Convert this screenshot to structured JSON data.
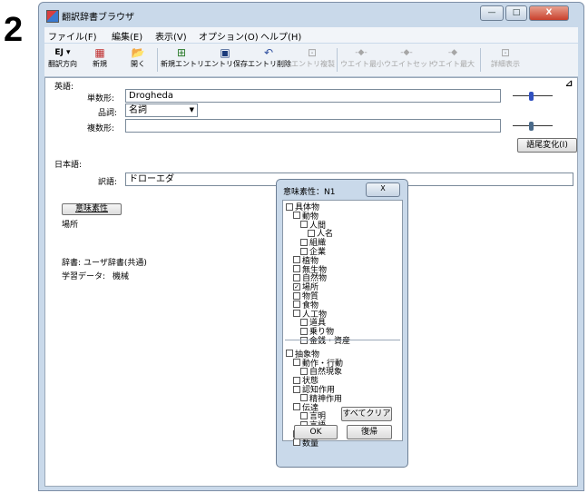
{
  "step_number": "2",
  "window": {
    "title": "翻訳辞書ブラウザ",
    "controls": [
      "—",
      "□",
      "X"
    ]
  },
  "menu": [
    "ファイル(F)",
    "編集(E)",
    "表示(V)",
    "オプション(O)",
    "ヘルプ(H)"
  ],
  "toolbar": [
    {
      "icon": "EJ ▾",
      "label": "翻訳方向",
      "disabled": false
    },
    {
      "icon": "▦",
      "label": "新規",
      "disabled": false
    },
    {
      "icon": "📂",
      "label": "開く",
      "disabled": false
    },
    {
      "icon": "⊞",
      "label": "新規エントリ",
      "disabled": false
    },
    {
      "icon": "▣",
      "label": "エントリ保存",
      "disabled": false
    },
    {
      "icon": "↶",
      "label": "エントリ削除",
      "disabled": false
    },
    {
      "icon": "⊡",
      "label": "エントリ複製",
      "disabled": true
    },
    {
      "icon": "-◆-",
      "label": "ウエイト最小",
      "disabled": true
    },
    {
      "icon": "-◆-",
      "label": "ウエイトセット",
      "disabled": true
    },
    {
      "icon": "-◆",
      "label": "ウエイト最大",
      "disabled": true
    },
    {
      "icon": "⊡",
      "label": "詳細表示",
      "disabled": true
    }
  ],
  "english": {
    "section_label": "英語:",
    "singular_label": "単数形:",
    "singular_value": "Drogheda",
    "pos_label": "品詞:",
    "pos_value": "名詞",
    "plural_label": "複数形:",
    "plural_value": "",
    "inflection_button": "語尾変化(I)",
    "corner_icon": "⊿"
  },
  "japanese": {
    "section_label": "日本語:",
    "translation_label": "訳語:",
    "translation_value": "ドローエダ"
  },
  "semantic_button": "意味素性",
  "semantic_value": "場所",
  "dictionary_label": "辞書:",
  "dictionary_value": "ユーザ辞書(共通)",
  "learning_label": "学習データ:",
  "learning_value": "機械",
  "popup": {
    "title": "意味素性：N1",
    "close_label": "X",
    "clear_all": "すべてクリア",
    "ok": "OK",
    "restore": "復帰",
    "categories": [
      {
        "label": "具体物",
        "checked": false,
        "level": 0
      },
      {
        "label": "動物",
        "checked": false,
        "level": 1
      },
      {
        "label": "人間",
        "checked": false,
        "level": 2
      },
      {
        "label": "人名",
        "checked": false,
        "level": 3
      },
      {
        "label": "組織",
        "checked": false,
        "level": 2
      },
      {
        "label": "企業",
        "checked": false,
        "level": 2
      },
      {
        "label": "植物",
        "checked": false,
        "level": 1
      },
      {
        "label": "無生物",
        "checked": false,
        "level": 1
      },
      {
        "label": "自然物",
        "checked": false,
        "level": 1
      },
      {
        "label": "場所",
        "checked": true,
        "level": 1
      },
      {
        "label": "物質",
        "checked": false,
        "level": 1
      },
      {
        "label": "食物",
        "checked": false,
        "level": 1
      },
      {
        "label": "人工物",
        "checked": false,
        "level": 1
      },
      {
        "label": "道具",
        "checked": false,
        "level": 2
      },
      {
        "label": "乗り物",
        "checked": false,
        "level": 2
      },
      {
        "label": "金銭・資産",
        "checked": false,
        "level": 2
      },
      {
        "label": "抽象物",
        "checked": false,
        "level": 0
      },
      {
        "label": "動作・行動",
        "checked": false,
        "level": 1
      },
      {
        "label": "自然現象",
        "checked": false,
        "level": 2
      },
      {
        "label": "状態",
        "checked": false,
        "level": 1
      },
      {
        "label": "認知作用",
        "checked": false,
        "level": 1
      },
      {
        "label": "精神作用",
        "checked": false,
        "level": 2
      },
      {
        "label": "伝達",
        "checked": false,
        "level": 1
      },
      {
        "label": "言明",
        "checked": false,
        "level": 2
      },
      {
        "label": "言語",
        "checked": false,
        "level": 2
      },
      {
        "label": "時間",
        "checked": false,
        "level": 1
      },
      {
        "label": "数量",
        "checked": false,
        "level": 1
      }
    ]
  }
}
